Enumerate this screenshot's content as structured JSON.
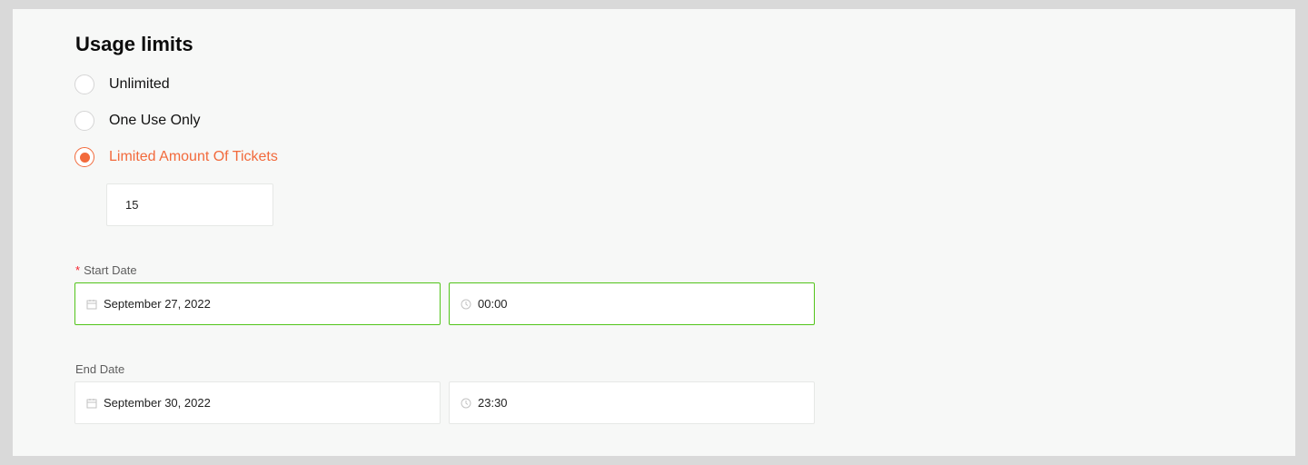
{
  "usage_limits": {
    "title": "Usage limits",
    "options": [
      {
        "label": "Unlimited",
        "checked": false
      },
      {
        "label": "One Use Only",
        "checked": false
      },
      {
        "label": "Limited Amount Of Tickets",
        "checked": true
      }
    ],
    "ticket_amount": "15"
  },
  "start_date": {
    "required_mark": "*",
    "label": "Start Date",
    "date": "September 27, 2022",
    "time": "00:00"
  },
  "end_date": {
    "label": "End Date",
    "date": "September 30, 2022",
    "time": "23:30"
  },
  "colors": {
    "accent": "#f26a3c",
    "focus_border": "#52c41a",
    "required": "#f5222d",
    "panel_bg": "#f7f8f7"
  },
  "icons": {
    "date": "calendar-icon",
    "time": "clock-icon"
  }
}
